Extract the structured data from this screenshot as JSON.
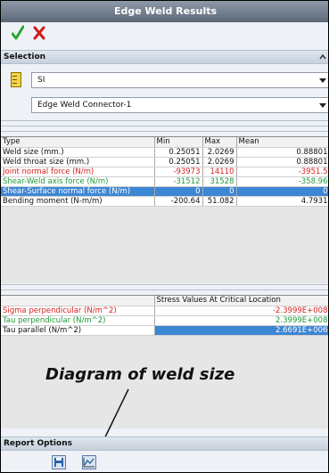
{
  "window": {
    "title": "Edge Weld Results"
  },
  "selection": {
    "header": "Selection",
    "unit_value": "SI",
    "connector_value": "Edge Weld Connector-1"
  },
  "results": {
    "columns": [
      "Type",
      "Min",
      "Max",
      "Mean"
    ],
    "rows": [
      {
        "type": "Weld size (mm.)",
        "min": "0.25051",
        "max": "2.0269",
        "mean": "0.88801"
      },
      {
        "type": "Weld throat size (mm.)",
        "min": "0.25051",
        "max": "2.0269",
        "mean": "0.88801"
      },
      {
        "type": "Joint normal force (N/m)",
        "min": "-93973",
        "max": "14110",
        "mean": "-3951.5"
      },
      {
        "type": "Shear-Weld axis force (N/m)",
        "min": "-31512",
        "max": "31528",
        "mean": "-358.96"
      },
      {
        "type": "Shear-Surface normal force (N/m)",
        "min": "0",
        "max": "0",
        "mean": "0"
      },
      {
        "type": "Bending moment (N-m/m)",
        "min": "-200.64",
        "max": "51.082",
        "mean": "4.7931"
      }
    ]
  },
  "critical": {
    "header": "Stress Values At Critical Location",
    "rows": [
      {
        "label": "Sigma perpendicular (N/m^2)",
        "value": "-2.3999E+008"
      },
      {
        "label": "Tau perpendicular (N/m^2)",
        "value": "2.3999E+008"
      },
      {
        "label": "Tau parallel (N/m^2)",
        "value": "2.6691E+006"
      }
    ]
  },
  "annotation": {
    "text": "Diagram of weld size"
  },
  "report": {
    "header": "Report Options"
  },
  "colors": {
    "red": "#d61f1f",
    "green": "#1f9a3a",
    "highlight": "#3d86d4",
    "title": "#6b7686"
  },
  "icons": [
    "check-icon",
    "close-icon",
    "ruler-icon",
    "chevron-up-icon",
    "dropdown-arrow-icon",
    "save-report-icon",
    "diagram-icon"
  ]
}
